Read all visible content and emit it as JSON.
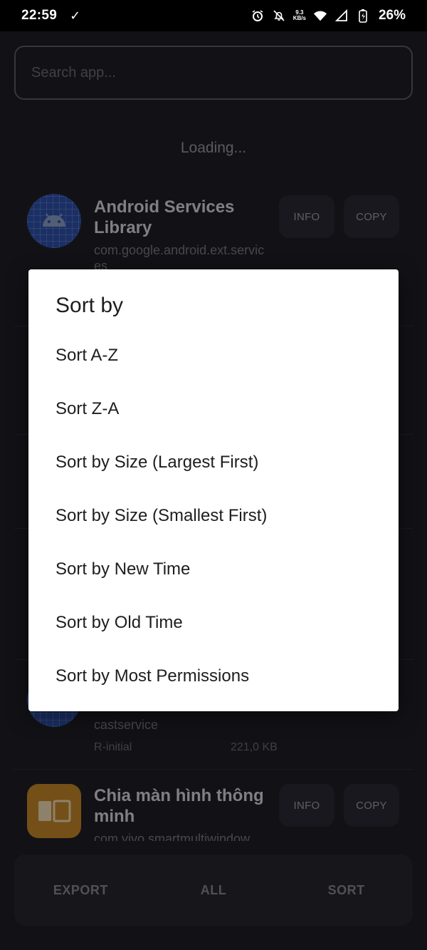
{
  "status_bar": {
    "time": "22:59",
    "net_speed_value": "9.3",
    "net_speed_unit": "KB/s",
    "battery": "26%"
  },
  "search": {
    "placeholder": "Search app..."
  },
  "loading_text": "Loading...",
  "apps": [
    {
      "name_line1": "Android Services",
      "name_line2": "Library",
      "package_line1": "com.google.android.ext.servic",
      "package_line2": "es",
      "info": "INFO",
      "copy": "COPY"
    },
    {
      "package_line2": "castservice",
      "meta": "R-initial",
      "size": "221,0 KB"
    },
    {
      "name_line1": "Chia màn hình thông",
      "name_line2": "minh",
      "package_line1": "com.vivo.smartmultiwindow",
      "info": "INFO",
      "copy": "COPY"
    }
  ],
  "bottom_bar": {
    "export": "EXPORT",
    "all": "ALL",
    "sort": "SORT"
  },
  "dialog": {
    "title": "Sort by",
    "options": [
      "Sort A-Z",
      "Sort Z-A",
      "Sort by Size (Largest First)",
      "Sort by Size (Smallest First)",
      "Sort by New Time",
      "Sort by Old Time",
      "Sort by Most Permissions"
    ]
  },
  "colors": {
    "background": "#1f1f26",
    "dialog": "#ffffff",
    "accent_icon": "#2d52ad",
    "orange_icon": "#c98a2a"
  }
}
